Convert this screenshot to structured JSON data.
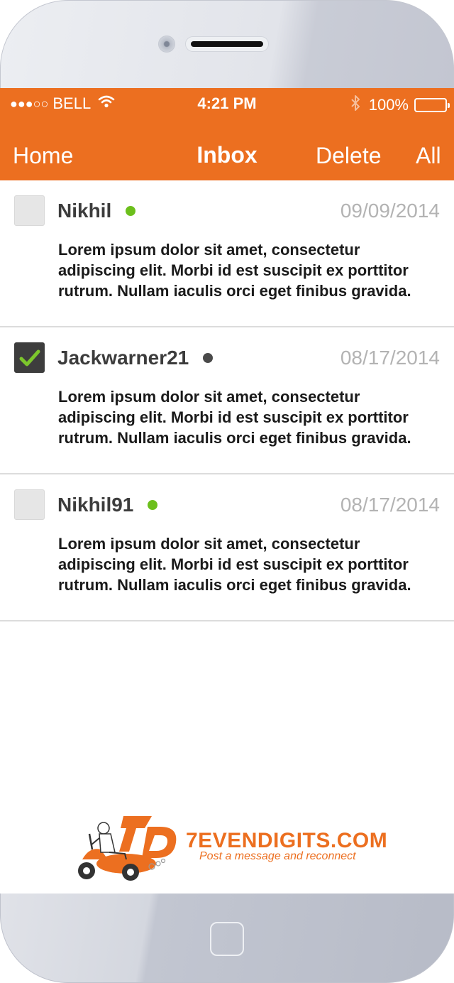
{
  "status": {
    "signal": "●●●○○",
    "carrier": "BELL",
    "time": "4:21 PM",
    "battery": "100%"
  },
  "nav": {
    "home": "Home",
    "title": "Inbox",
    "delete": "Delete",
    "all": "All"
  },
  "messages": [
    {
      "name": "Nikhil",
      "online": true,
      "date": "09/09/2014",
      "checked": false,
      "body": "Lorem ipsum dolor sit amet, consectetur adipiscing elit. Morbi id est suscipit ex porttitor rutrum. Nullam iaculis orci eget finibus gravida."
    },
    {
      "name": "Jackwarner21",
      "online": false,
      "date": "08/17/2014",
      "checked": true,
      "body": "Lorem ipsum dolor sit amet, consectetur adipiscing elit. Morbi id est suscipit ex porttitor rutrum. Nullam iaculis orci eget finibus gravida."
    },
    {
      "name": "Nikhil91",
      "online": true,
      "date": "08/17/2014",
      "checked": false,
      "body": "Lorem ipsum dolor sit amet, consectetur adipiscing elit. Morbi id est suscipit ex porttitor rutrum. Nullam iaculis orci eget finibus gravida."
    }
  ],
  "brand": {
    "logo_mark": "7D",
    "name": "7EVENDIGITS.COM",
    "tagline": "Post a message and reconnect"
  },
  "colors": {
    "accent": "#ec6f20",
    "online": "#6cbf1c",
    "offline": "#4a4a4a",
    "check": "#7cc62c"
  },
  "icons": {
    "wifi": "wifi-icon",
    "bluetooth": "bluetooth-icon",
    "battery": "battery-icon",
    "checkmark": "checkmark-icon"
  }
}
